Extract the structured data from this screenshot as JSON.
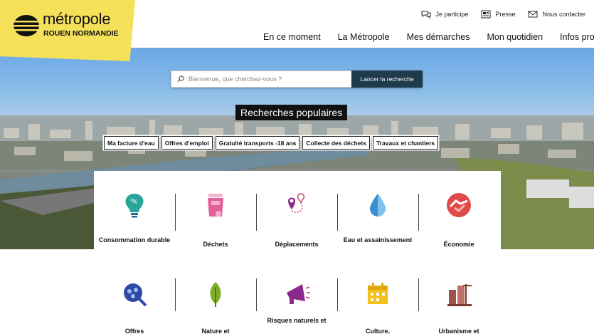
{
  "logo": {
    "title": "métropole",
    "subtitle_a": "Rouen",
    "subtitle_b": " NORMANDIE"
  },
  "utility": [
    {
      "label": "Je participe",
      "icon": "participate-icon"
    },
    {
      "label": "Presse",
      "icon": "newspaper-icon"
    },
    {
      "label": "Nous contacter",
      "icon": "mail-icon"
    }
  ],
  "nav": [
    "En ce moment",
    "La Métropole",
    "Mes démarches",
    "Mon quotidien",
    "Infos pro"
  ],
  "search": {
    "placeholder": "Bienvenue, que cherchez-vous ?",
    "button": "Lancer la recherche"
  },
  "popular": {
    "title": "Recherches populaires",
    "chips": [
      "Ma facture d'eau",
      "Offres d'emploi",
      "Gratuité transports -18 ans",
      "Collecte des déchets",
      "Travaux et chantiers"
    ]
  },
  "themes": [
    {
      "label": "Consommation durable",
      "icon": "lightbulb-leaf-icon"
    },
    {
      "label": "Déchets",
      "icon": "trash-bin-icon"
    },
    {
      "label": "Déplacements",
      "icon": "route-pin-icon"
    },
    {
      "label": "Eau et assainissement",
      "icon": "water-drop-icon"
    },
    {
      "label": "Économie",
      "icon": "handshake-icon"
    },
    {
      "label": "Offres",
      "icon": "people-search-icon"
    },
    {
      "label": "Nature et",
      "icon": "leaf-icon"
    },
    {
      "label": "Risques naturels et",
      "icon": "megaphone-icon"
    },
    {
      "label": "Culture,",
      "icon": "calendar-icon"
    },
    {
      "label": "Urbanisme et",
      "icon": "city-crane-icon"
    }
  ],
  "colors": {
    "logo_bg": "#f5e05a",
    "search_button": "#1f3a4a",
    "teal": "#2aa39a",
    "pink": "#e0609a",
    "purple": "#8a2a8a",
    "blue": "#3a8fd0",
    "red": "#e04a4a"
  }
}
